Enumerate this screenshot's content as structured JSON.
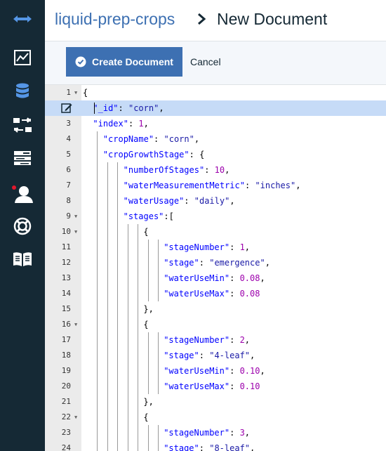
{
  "header": {
    "breadcrumb_db": "liquid-prep-crops",
    "breadcrumb_current": "New Document"
  },
  "toolbar": {
    "create_label": "Create Document",
    "cancel_label": "Cancel"
  },
  "sidebar": {
    "items": [
      {
        "icon": "collapse-arrows-icon"
      },
      {
        "icon": "monitoring-chart-icon"
      },
      {
        "icon": "databases-icon"
      },
      {
        "icon": "replication-icon"
      },
      {
        "icon": "active-tasks-icon"
      },
      {
        "icon": "account-icon",
        "badge": true
      },
      {
        "icon": "support-icon"
      },
      {
        "icon": "documentation-icon"
      }
    ]
  },
  "editor": {
    "lines": [
      {
        "n": "1",
        "fold": true,
        "guides": 0,
        "tokens": [
          [
            "p",
            "{"
          ]
        ]
      },
      {
        "n": "2",
        "active": true,
        "guides": 0,
        "indent": 1,
        "tokens": [
          [
            "k",
            "\"_id\""
          ],
          [
            "p",
            ": "
          ],
          [
            "s2",
            "\"corn\""
          ],
          [
            "p",
            ","
          ]
        ]
      },
      {
        "n": "3",
        "guides": 0,
        "indent": 1,
        "tokens": [
          [
            "k",
            "\"index\""
          ],
          [
            "p",
            ": "
          ],
          [
            "n",
            "1"
          ],
          [
            "p",
            ","
          ]
        ]
      },
      {
        "n": "4",
        "guides": 1,
        "tokens": [
          [
            "k",
            "\"cropName\""
          ],
          [
            "p",
            ": "
          ],
          [
            "s2",
            "\"corn\""
          ],
          [
            "p",
            ","
          ]
        ]
      },
      {
        "n": "5",
        "guides": 1,
        "tokens": [
          [
            "k",
            "\"cropGrowthStage\""
          ],
          [
            "p",
            ": {"
          ]
        ]
      },
      {
        "n": "6",
        "guides": 3,
        "tokens": [
          [
            "k",
            "\"numberOfStages\""
          ],
          [
            "p",
            ": "
          ],
          [
            "n",
            "10"
          ],
          [
            "p",
            ","
          ]
        ]
      },
      {
        "n": "7",
        "guides": 3,
        "tokens": [
          [
            "k",
            "\"waterMeasurementMetric\""
          ],
          [
            "p",
            ": "
          ],
          [
            "s2",
            "\"inches\""
          ],
          [
            "p",
            ","
          ]
        ]
      },
      {
        "n": "8",
        "guides": 3,
        "tokens": [
          [
            "k",
            "\"waterUsage\""
          ],
          [
            "p",
            ": "
          ],
          [
            "s2",
            "\"daily\""
          ],
          [
            "p",
            ","
          ]
        ]
      },
      {
        "n": "9",
        "fold": true,
        "guides": 3,
        "tokens": [
          [
            "k",
            "\"stages\""
          ],
          [
            "p",
            ":["
          ]
        ]
      },
      {
        "n": "10",
        "fold": true,
        "guides": 5,
        "tokens": [
          [
            "p",
            "{"
          ]
        ]
      },
      {
        "n": "11",
        "guides": 7,
        "tokens": [
          [
            "k",
            "\"stageNumber\""
          ],
          [
            "p",
            ": "
          ],
          [
            "n",
            "1"
          ],
          [
            "p",
            ","
          ]
        ]
      },
      {
        "n": "12",
        "guides": 7,
        "tokens": [
          [
            "k",
            "\"stage\""
          ],
          [
            "p",
            ": "
          ],
          [
            "s2",
            "\"emergence\""
          ],
          [
            "p",
            ","
          ]
        ]
      },
      {
        "n": "13",
        "guides": 7,
        "tokens": [
          [
            "k",
            "\"waterUseMin\""
          ],
          [
            "p",
            ": "
          ],
          [
            "n",
            "0.08"
          ],
          [
            "p",
            ","
          ]
        ]
      },
      {
        "n": "14",
        "guides": 7,
        "tokens": [
          [
            "k",
            "\"waterUseMax\""
          ],
          [
            "p",
            ": "
          ],
          [
            "n",
            "0.08"
          ]
        ]
      },
      {
        "n": "15",
        "guides": 5,
        "tokens": [
          [
            "p",
            "},"
          ]
        ]
      },
      {
        "n": "16",
        "fold": true,
        "guides": 5,
        "tokens": [
          [
            "p",
            "{"
          ]
        ]
      },
      {
        "n": "17",
        "guides": 7,
        "tokens": [
          [
            "k",
            "\"stageNumber\""
          ],
          [
            "p",
            ": "
          ],
          [
            "n",
            "2"
          ],
          [
            "p",
            ","
          ]
        ]
      },
      {
        "n": "18",
        "guides": 7,
        "tokens": [
          [
            "k",
            "\"stage\""
          ],
          [
            "p",
            ": "
          ],
          [
            "s2",
            "\"4-leaf\""
          ],
          [
            "p",
            ","
          ]
        ]
      },
      {
        "n": "19",
        "guides": 7,
        "tokens": [
          [
            "k",
            "\"waterUseMin\""
          ],
          [
            "p",
            ": "
          ],
          [
            "n",
            "0.10"
          ],
          [
            "p",
            ","
          ]
        ]
      },
      {
        "n": "20",
        "guides": 7,
        "tokens": [
          [
            "k",
            "\"waterUseMax\""
          ],
          [
            "p",
            ": "
          ],
          [
            "n",
            "0.10"
          ]
        ]
      },
      {
        "n": "21",
        "guides": 5,
        "tokens": [
          [
            "p",
            "},"
          ]
        ]
      },
      {
        "n": "22",
        "fold": true,
        "guides": 5,
        "tokens": [
          [
            "p",
            "{"
          ]
        ]
      },
      {
        "n": "23",
        "guides": 7,
        "tokens": [
          [
            "k",
            "\"stageNumber\""
          ],
          [
            "p",
            ": "
          ],
          [
            "n",
            "3"
          ],
          [
            "p",
            ","
          ]
        ]
      },
      {
        "n": "24",
        "guides": 7,
        "tokens": [
          [
            "k",
            "\"stage\""
          ],
          [
            "p",
            ": "
          ],
          [
            "s2",
            "\"8-leaf\""
          ],
          [
            "p",
            ","
          ]
        ]
      }
    ]
  },
  "colors": {
    "sidebar_bg": "#152935",
    "accent": "#3d70b2",
    "icon_active": "#5596e6",
    "badge": "#e0182d",
    "active_line": "#c6dbf7",
    "json_key": "#0000ff",
    "json_string": "#1a1aa6",
    "json_number": "#9c00ac"
  }
}
